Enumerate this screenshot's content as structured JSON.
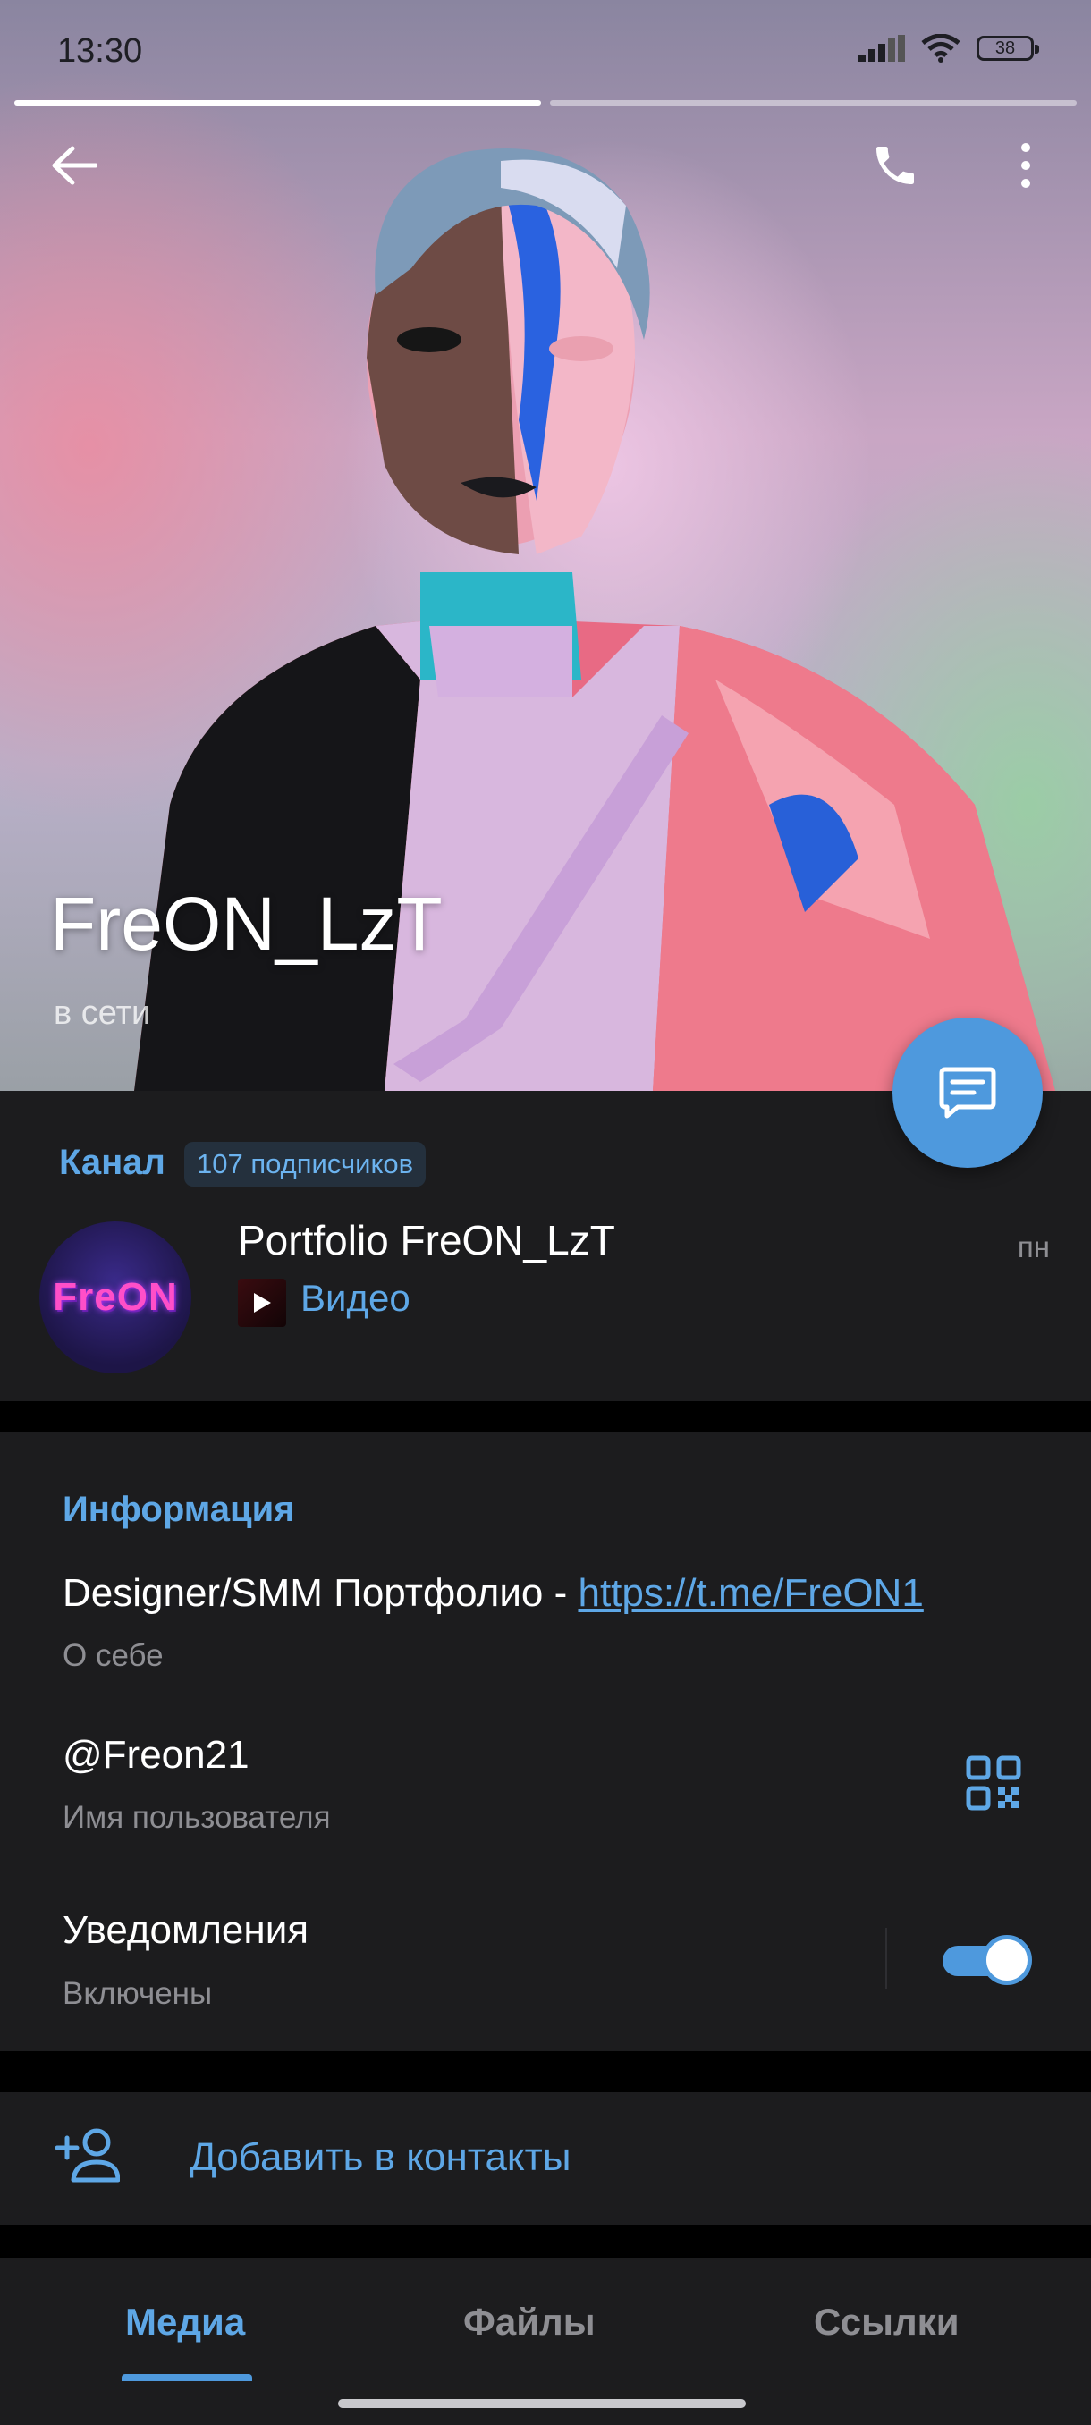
{
  "status_bar": {
    "time": "13:30",
    "battery": "38",
    "icons": [
      "signal-icon",
      "wifi-icon",
      "battery-icon"
    ]
  },
  "header": {
    "back_icon": "back-arrow-icon",
    "call_icon": "phone-icon",
    "menu_icon": "more-vert-icon"
  },
  "profile": {
    "name": "FreON_LzT",
    "presence": "в сети",
    "message_button_icon": "message-icon"
  },
  "channel": {
    "label": "Канал",
    "subscribers": "107 подписчиков",
    "avatar_text": "FreON",
    "title": "Portfolio FreON_LzT",
    "day": "пн",
    "preview": "Видео"
  },
  "info": {
    "label": "Информация",
    "bio_text": "Designer/SMM Портфолио - ",
    "bio_link": "https://t.me/FreON1",
    "bio_caption": "О себе",
    "username": "@Freon21",
    "username_caption": "Имя пользователя",
    "notifications": "Уведомления",
    "notifications_state": "Включены",
    "notifications_on": true
  },
  "add_contact": {
    "label": "Добавить в контакты"
  },
  "tabs": [
    {
      "label": "Медиа",
      "active": true
    },
    {
      "label": "Файлы",
      "active": false
    },
    {
      "label": "Ссылки",
      "active": false
    }
  ],
  "colors": {
    "accent": "#4e99dd",
    "link": "#5ea7e6",
    "card": "#1c1c1e",
    "background": "#000000"
  }
}
